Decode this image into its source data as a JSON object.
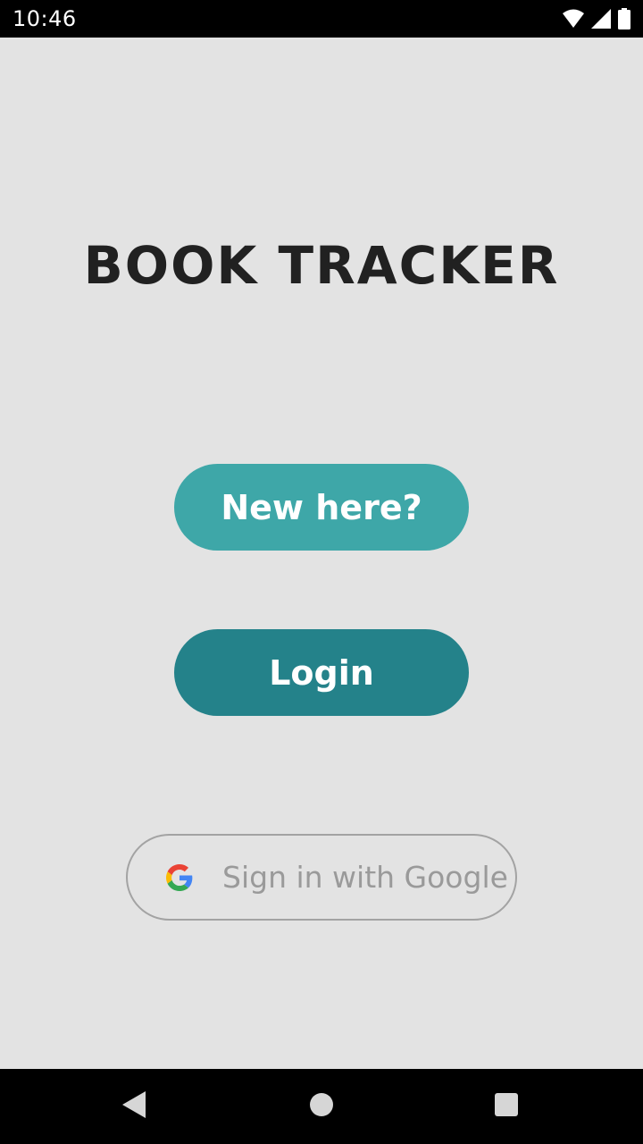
{
  "status_bar": {
    "time": "10:46",
    "icons": [
      "wifi-icon",
      "cell-signal-icon",
      "battery-icon"
    ]
  },
  "app": {
    "title": "BOOK TRACKER"
  },
  "buttons": {
    "new_here": "New here?",
    "login": "Login",
    "google_sign_in": "Sign in with Google"
  },
  "nav_bar": {
    "icons": [
      "back-icon",
      "home-icon",
      "recents-icon"
    ]
  },
  "colors": {
    "background": "#e3e3e3",
    "new_here_button": "#3ea7a8",
    "login_button": "#24828a",
    "title_text": "#212121"
  }
}
